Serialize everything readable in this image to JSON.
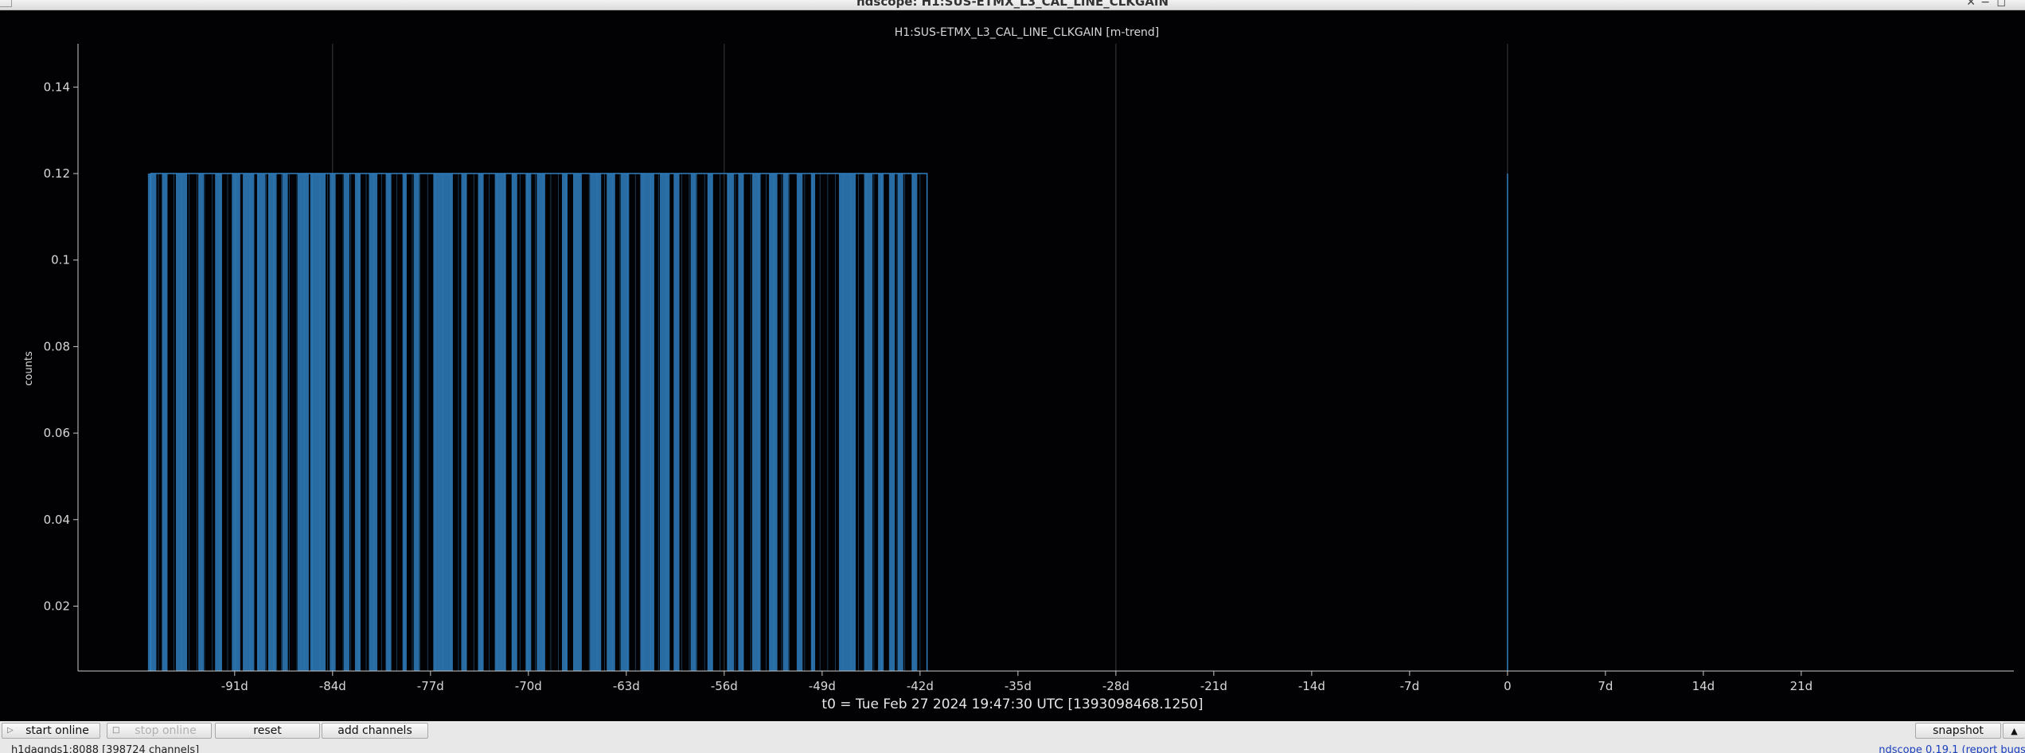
{
  "window": {
    "title": "ndscope: H1:SUS-ETMX_L3_CAL_LINE_CLKGAIN",
    "close_icon": "✕",
    "minimize_icon": "−",
    "maximize_icon": "◻"
  },
  "plot": {
    "background": "#020204",
    "axis_color": "#c8c8c8",
    "grid_color": "#3a3a3a"
  },
  "chart_data": {
    "type": "bar",
    "title": "H1:SUS-ETMX_L3_CAL_LINE_CLKGAIN [m-trend]",
    "ylabel": "counts",
    "xlabel": "t0 = Tue Feb 27 2024 19:47:30 UTC [1393098468.1250]",
    "xlim": [
      -102.2,
      36.2
    ],
    "ylim": [
      0.005,
      0.15
    ],
    "x_ticks": [
      "-91d",
      "-84d",
      "-77d",
      "-70d",
      "-63d",
      "-56d",
      "-49d",
      "-42d",
      "-35d",
      "-28d",
      "-21d",
      "-14d",
      "-7d",
      "0",
      "7d",
      "14d",
      "21d"
    ],
    "x_tick_values": [
      -91,
      -84,
      -77,
      -70,
      -63,
      -56,
      -49,
      -42,
      -35,
      -28,
      -21,
      -14,
      -7,
      0,
      7,
      14,
      21
    ],
    "y_ticks": [
      "0.02",
      "0.04",
      "0.06",
      "0.08",
      "0.1",
      "0.12",
      "0.14"
    ],
    "y_tick_values": [
      0.02,
      0.04,
      0.06,
      0.08,
      0.1,
      0.12,
      0.14
    ],
    "grid": "vertical at -84d, -56d, -28d, 0",
    "series_color": "#2f7fc0",
    "outline_value": 0.12,
    "outline_range_days": [
      -97,
      -41.5
    ],
    "segments_days": [
      [
        -97.2,
        -96.6
      ],
      [
        -96.2,
        -95.8
      ],
      [
        -95.2,
        -94.4
      ],
      [
        -93.6,
        -93.2
      ],
      [
        -92.4,
        -91.9
      ],
      [
        -91.2,
        -90.6
      ],
      [
        -90.4,
        -89.6
      ],
      [
        -89.4,
        -88.8
      ],
      [
        -88.6,
        -88.0
      ],
      [
        -87.6,
        -87.2
      ],
      [
        -86.5,
        -85.7
      ],
      [
        -85.6,
        -84.5
      ],
      [
        -84.2,
        -83.8
      ],
      [
        -83.2,
        -82.8
      ],
      [
        -82.4,
        -82.0
      ],
      [
        -81.4,
        -80.8
      ],
      [
        -80.2,
        -79.8
      ],
      [
        -79.0,
        -78.7
      ],
      [
        -78.2,
        -77.8
      ],
      [
        -76.8,
        -75.4
      ],
      [
        -74.8,
        -74.4
      ],
      [
        -73.6,
        -73.2
      ],
      [
        -72.4,
        -71.6
      ],
      [
        -71.2,
        -70.8
      ],
      [
        -70.2,
        -69.8
      ],
      [
        -69.4,
        -68.8
      ],
      [
        -67.6,
        -67.2
      ],
      [
        -66.8,
        -66.2
      ],
      [
        -65.6,
        -64.8
      ],
      [
        -64.4,
        -63.8
      ],
      [
        -63.4,
        -62.8
      ],
      [
        -62.0,
        -61.0
      ],
      [
        -60.6,
        -59.9
      ],
      [
        -59.6,
        -59.2
      ],
      [
        -58.4,
        -58.0
      ],
      [
        -57.2,
        -56.8
      ],
      [
        -55.8,
        -55.3
      ],
      [
        -55.0,
        -54.6
      ],
      [
        -54.0,
        -53.4
      ],
      [
        -52.8,
        -52.2
      ],
      [
        -51.8,
        -51.4
      ],
      [
        -50.8,
        -50.4
      ],
      [
        -49.8,
        -49.5
      ],
      [
        -47.8,
        -46.6
      ],
      [
        -46.0,
        -45.4
      ],
      [
        -45.0,
        -44.6
      ],
      [
        -44.2,
        -43.8
      ],
      [
        -43.6,
        -43.2
      ],
      [
        -42.6,
        -42.2
      ]
    ],
    "spike_days": 0,
    "spike_value": 0.12
  },
  "toolbar": {
    "start_online": "start online",
    "stop_online": "stop online",
    "reset": "reset",
    "add_channels": "add channels",
    "snapshot": "snapshot",
    "expand_icon": "▲"
  },
  "status": {
    "server": "h1daqnds1:8088  [398724 channels]",
    "version": "ndscope 0.19.1 (report bugs)"
  }
}
